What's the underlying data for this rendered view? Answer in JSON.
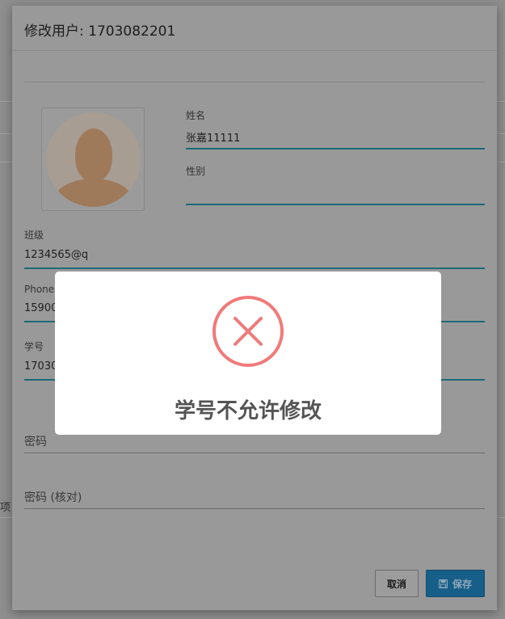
{
  "background": {
    "side_text": "项"
  },
  "dialog": {
    "title": "修改用户: 1703082201",
    "avatar_icon": "default-user-avatar",
    "fields": {
      "name": {
        "label": "姓名",
        "value": "张嘉11111"
      },
      "gender": {
        "label": "性别",
        "value": ""
      },
      "class": {
        "label": "班级",
        "value": "1234565@q"
      },
      "phone": {
        "label": "Phone",
        "value": "15900"
      },
      "student_id": {
        "label": "学号",
        "value": "17030"
      }
    },
    "password": {
      "placeholder": "密码"
    },
    "password_confirm": {
      "placeholder": "密码 (核对)"
    },
    "buttons": {
      "cancel": "取消",
      "save": "保存",
      "save_icon": "save-icon"
    }
  },
  "alert": {
    "icon": "error-x-icon",
    "message": "学号不允许修改",
    "icon_color": "#f07a7a"
  },
  "colors": {
    "field_underline": "#1e6a78",
    "save_button": "#175f88",
    "overlay": "#8e8e8e"
  }
}
